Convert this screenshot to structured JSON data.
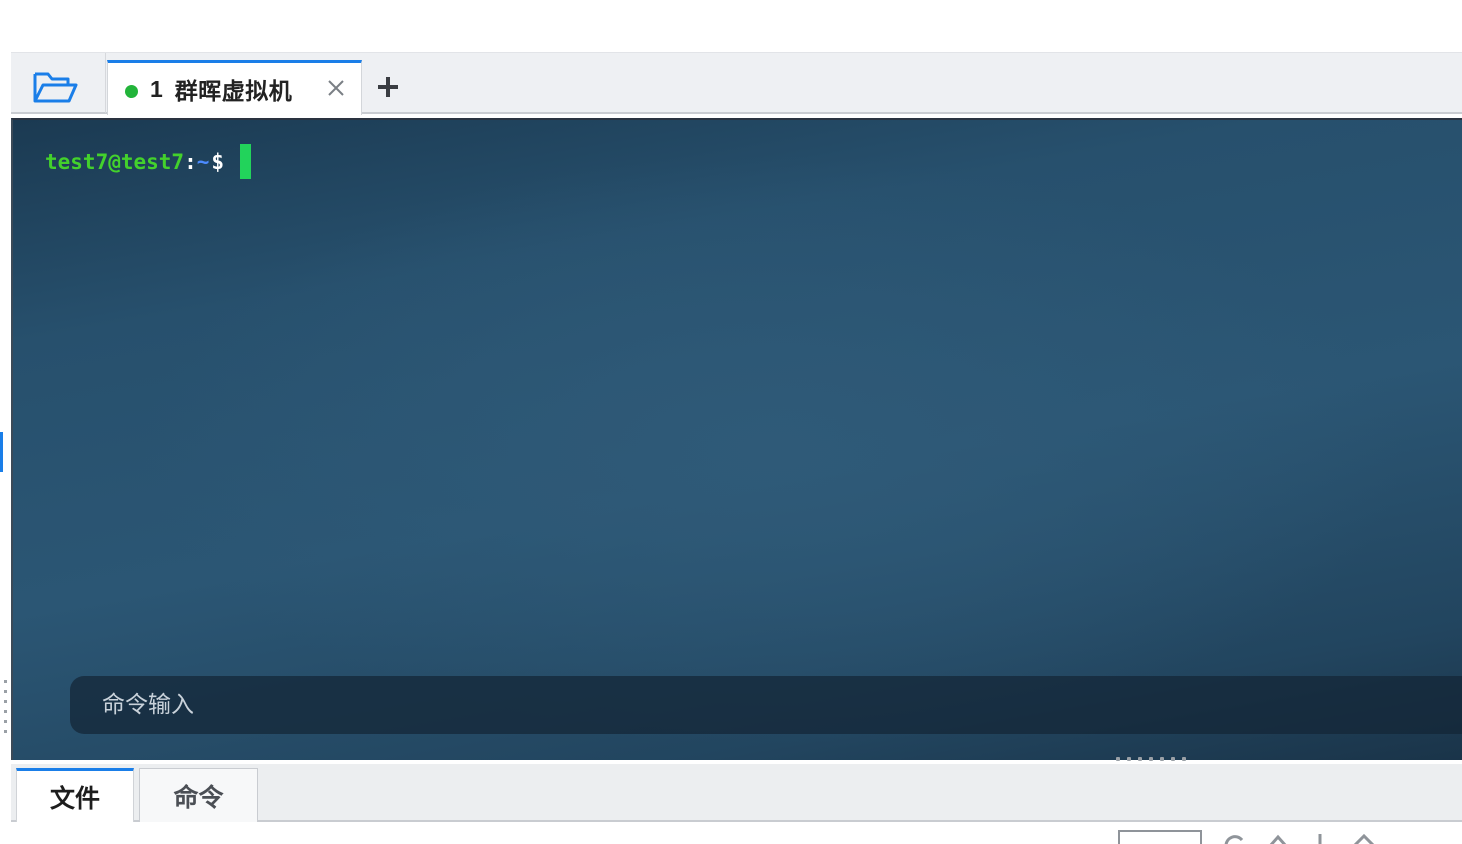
{
  "tabbar": {
    "session_tab": {
      "number": "1",
      "title": "群晖虚拟机",
      "status_color": "#22b43a"
    },
    "accent_color": "#1a7ee8"
  },
  "terminal": {
    "prompt_user_host": "test7@test7",
    "prompt_colon": ":",
    "prompt_path": "~",
    "prompt_symbol": "$",
    "cursor_color": "#22d35b"
  },
  "command_input": {
    "placeholder": "命令输入"
  },
  "bottom_tabs": {
    "files_label": "文件",
    "commands_label": "命令"
  }
}
